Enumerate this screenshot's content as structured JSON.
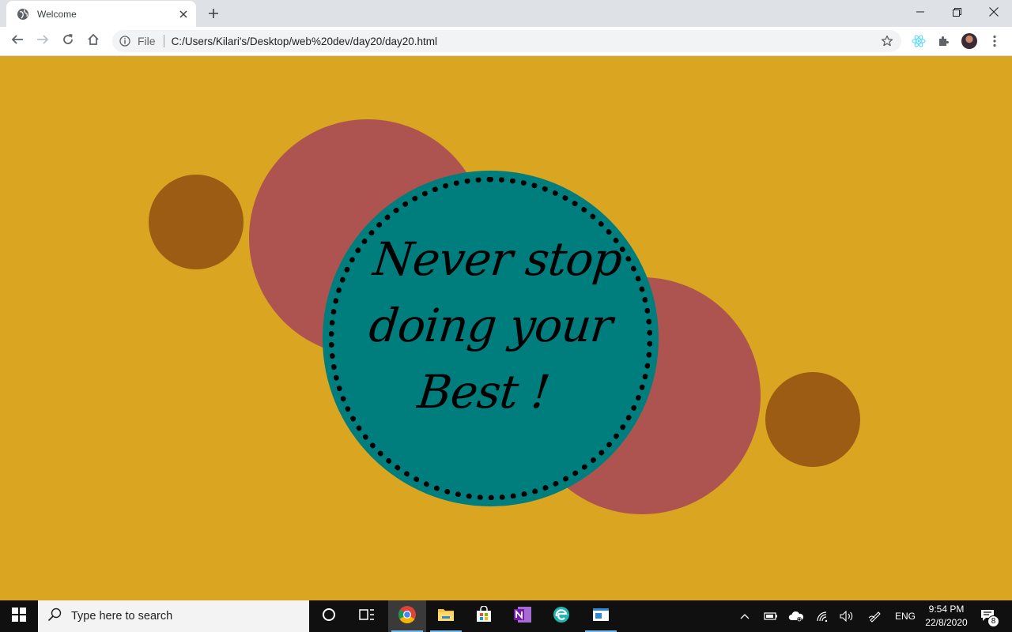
{
  "browser": {
    "tab_title": "Welcome",
    "omnibox_chip": "File",
    "url": "C:/Users/Kilari's/Desktop/web%20dev/day20/day20.html"
  },
  "page": {
    "quote_line1": "Never stop",
    "quote_line2": "doing your",
    "quote_line3": "Best !",
    "colors": {
      "background": "#daa520",
      "small_circles": "#9c5c14",
      "big_circles": "#ae5450",
      "main_circle": "#007d7d",
      "dots": "#000000"
    }
  },
  "taskbar": {
    "search_placeholder": "Type here to search",
    "language": "ENG",
    "time": "9:54 PM",
    "date": "22/8/2020",
    "notification_count": "8"
  }
}
